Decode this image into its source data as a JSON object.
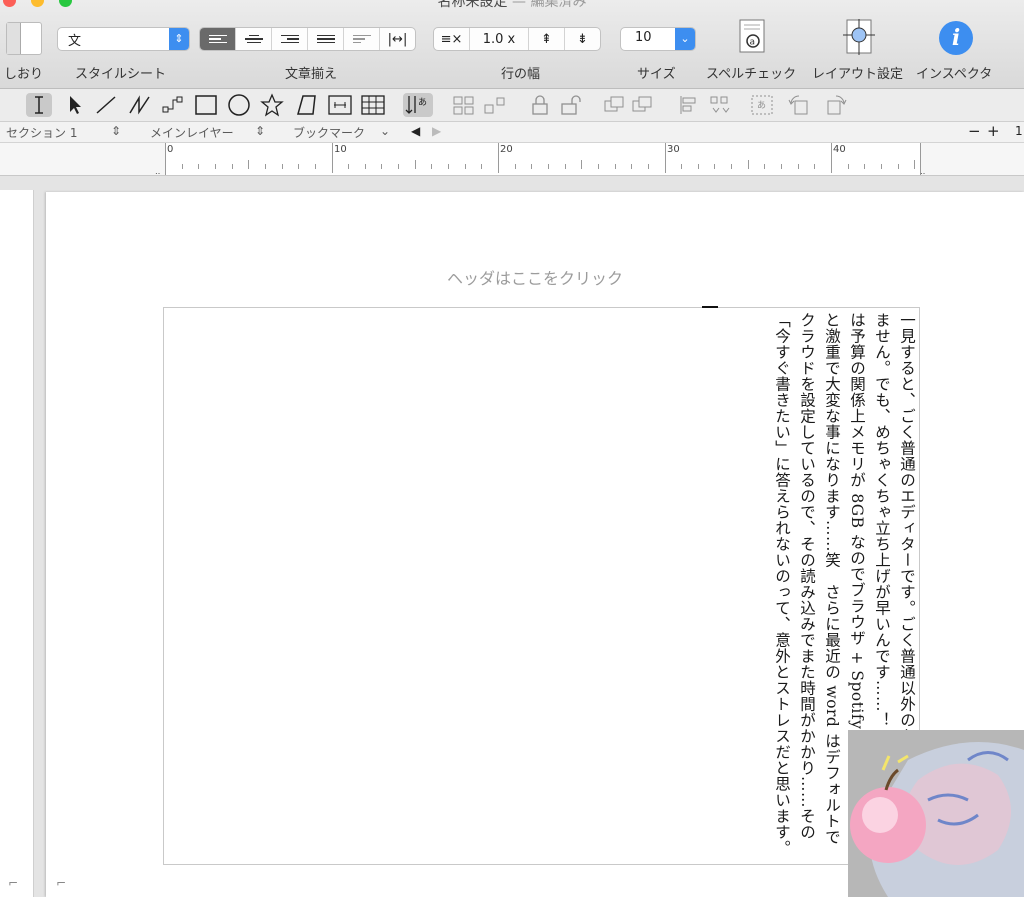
{
  "window": {
    "title": "名称未設定",
    "subtitle": "— 編集済み"
  },
  "toolbar": {
    "items": [
      {
        "label": "しおり"
      },
      {
        "label": "スタイルシート",
        "value": "文"
      },
      {
        "label": "文章揃え"
      },
      {
        "label": "行の幅",
        "value": "1.0 x"
      },
      {
        "label": "サイズ",
        "value": "10"
      },
      {
        "label": "スペルチェック"
      },
      {
        "label": "レイアウト設定"
      },
      {
        "label": "インスペクタ"
      }
    ]
  },
  "tools": [
    "text-cursor-icon",
    "arrow-pointer-icon",
    "line-icon",
    "freehand-line-icon",
    "connector-icon",
    "rectangle-icon",
    "ellipse-icon",
    "star-icon",
    "polygon-icon",
    "text-box-icon",
    "table-icon",
    "vertical-text-icon",
    "group-icon",
    "ungroup-icon",
    "lock-icon",
    "unlock-icon",
    "bring-front-icon",
    "align-icon",
    "distribute-icon",
    "wrap-icon",
    "rotate-left-icon",
    "rotate-right-icon"
  ],
  "section_bar": {
    "section": "セクション 1",
    "layer": "メインレイヤー",
    "bookmark": "ブックマーク",
    "zoom_out": "−",
    "zoom_in": "+",
    "zoom_value": "1"
  },
  "ruler": {
    "marks": [
      "0",
      "10",
      "20",
      "30",
      "40"
    ]
  },
  "document": {
    "header_hint": "ヘッダはここをクリック",
    "body": "一見すると、ごく普通のエディターです。ごく普通以外のなにものでもありません。でも、めちゃくちゃ立ち上げが早いんです……！　わたしの iMac は予算の関係上メモリが 8GB なのでブラウザ + Spotify + word を使うと激重で大変な事になります……笑　さらに最近の word はデフォルトでクラウドを設定しているので、その読み込みでまた時間がかかり……その「今すぐ書きたい」に答えられないのって、意外とストレスだと思います。"
  },
  "colors": {
    "accent": "#3d8ef0",
    "info_icon": "#3d8ef0",
    "selected_segment": "#6a6a6a"
  }
}
